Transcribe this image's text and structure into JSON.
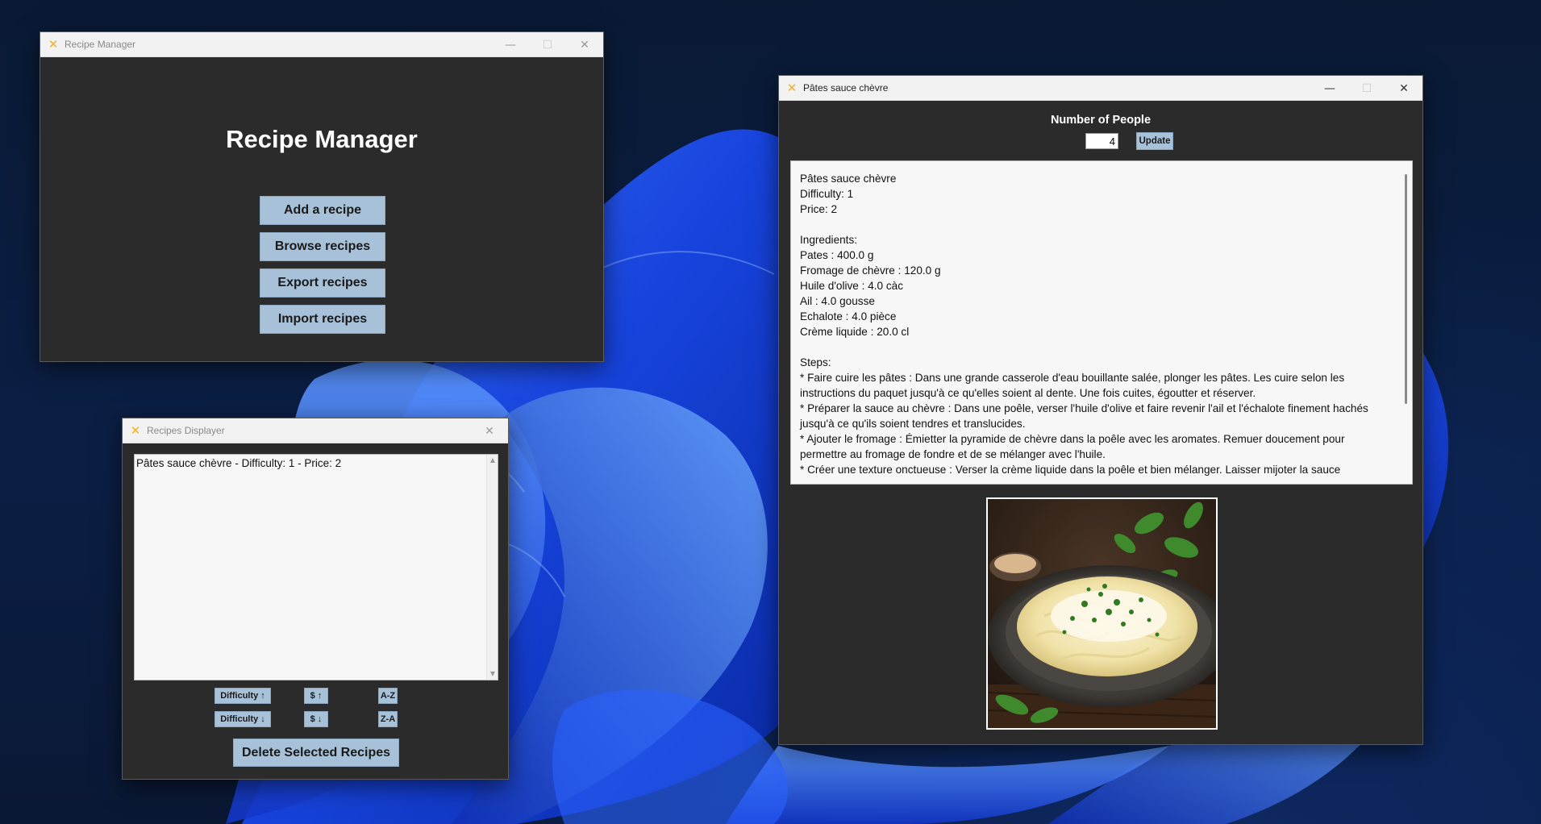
{
  "colors": {
    "window_bg": "#2b2b2b",
    "button_bg": "#a7c1d9",
    "text_area_bg": "#f7f7f7",
    "titlebar_bg": "#f2f2f2",
    "wallpaper_accent": "#1f5cff"
  },
  "manager": {
    "title": "Recipe Manager",
    "app_icon": "feather-icon",
    "heading": "Recipe Manager",
    "buttons": {
      "add": "Add a recipe",
      "browse": "Browse recipes",
      "export": "Export recipes",
      "import": "Import recipes"
    }
  },
  "displayer": {
    "title": "Recipes Displayer",
    "app_icon": "feather-icon",
    "items": [
      "Pâtes sauce chèvre - Difficulty: 1 - Price: 2"
    ],
    "sort": {
      "difficulty_asc": "Difficulty ↑",
      "difficulty_desc": "Difficulty ↓",
      "price_asc": "$ ↑",
      "price_desc": "$ ↓",
      "az": "A-Z",
      "za": "Z-A"
    },
    "delete_label": "Delete Selected Recipes"
  },
  "recipe": {
    "title": "Pâtes sauce chèvre",
    "app_icon": "feather-icon",
    "people_label": "Number of People",
    "people_value": "4",
    "update_label": "Update",
    "name_line": "Pâtes sauce chèvre",
    "difficulty_line": "Difficulty: 1",
    "price_line": "Price: 2",
    "ingredients_header": "Ingredients:",
    "ingredients": [
      "Pates : 400.0 g",
      "Fromage de chèvre : 120.0 g",
      "Huile d'olive : 4.0 càc",
      "Ail : 4.0 gousse",
      "Echalote : 4.0 pièce",
      "Crème liquide : 20.0 cl"
    ],
    "steps_header": "Steps:",
    "steps": [
      "* Faire cuire les pâtes : Dans une grande casserole d'eau bouillante salée, plonger les pâtes. Les cuire selon les instructions du paquet jusqu'à ce qu'elles soient al dente. Une fois cuites, égoutter et réserver.",
      "* Préparer la sauce au chèvre : Dans une poêle, verser l'huile d'olive et faire revenir l'ail et l'échalote finement hachés jusqu'à ce qu'ils soient tendres et translucides.",
      "* Ajouter le fromage : Émietter la pyramide de chèvre dans la poêle avec les aromates. Remuer doucement pour permettre au fromage de fondre et de se mélanger avec l'huile.",
      "* Créer une texture onctueuse : Verser la crème liquide dans la poêle et bien mélanger. Laisser mijoter la sauce"
    ],
    "image_label": "pasta-dish-photo"
  }
}
